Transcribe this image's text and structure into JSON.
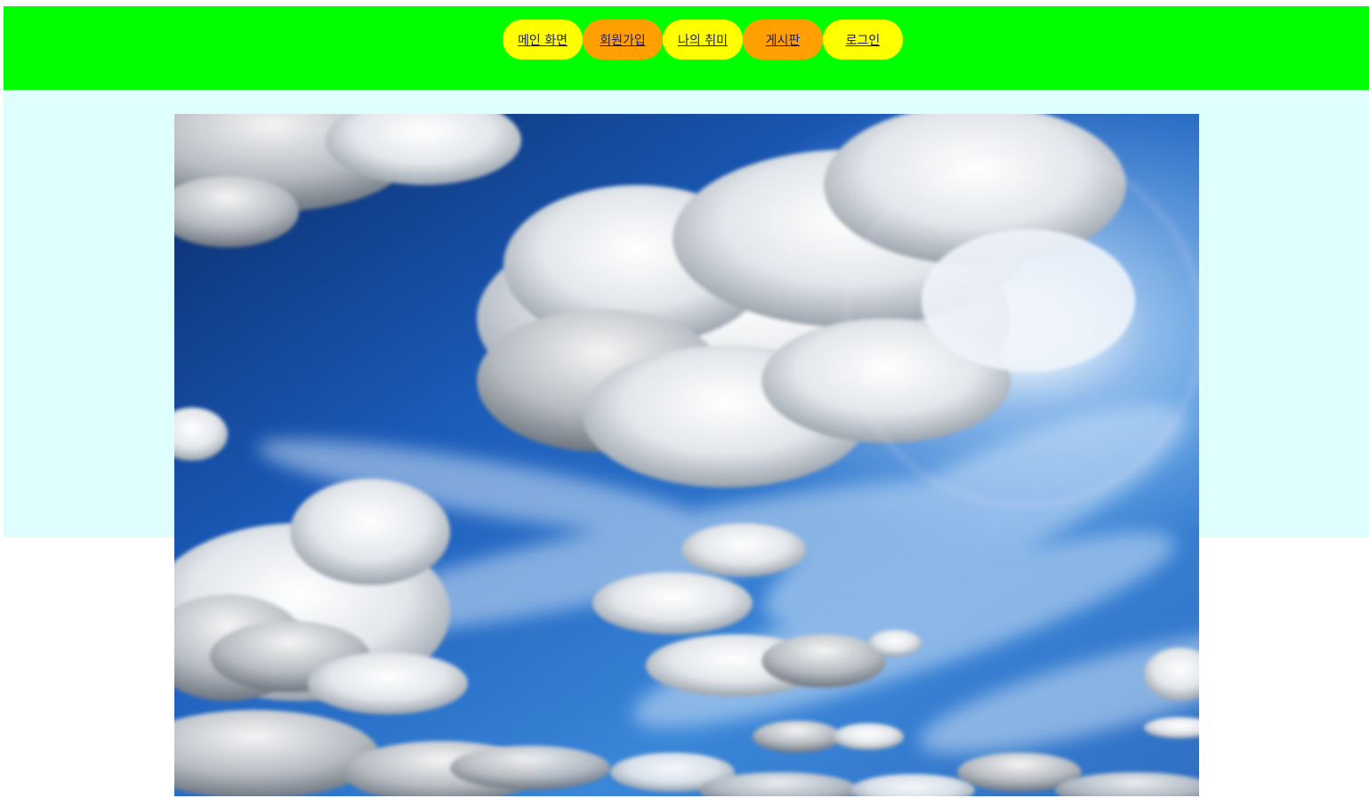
{
  "nav": {
    "items": [
      {
        "label": "메인 화면",
        "color": "#ffff00"
      },
      {
        "label": "회원가입",
        "color": "#ff9f00"
      },
      {
        "label": "나의 취미",
        "color": "#ffff00"
      },
      {
        "label": "게시판",
        "color": "#ff9f00"
      },
      {
        "label": "로그인",
        "color": "#ffff00"
      }
    ]
  },
  "theme": {
    "header_bg": "#00ff00",
    "content_bg": "#dfffff"
  },
  "hero": {
    "subject": "sky-with-clouds-and-sun"
  }
}
